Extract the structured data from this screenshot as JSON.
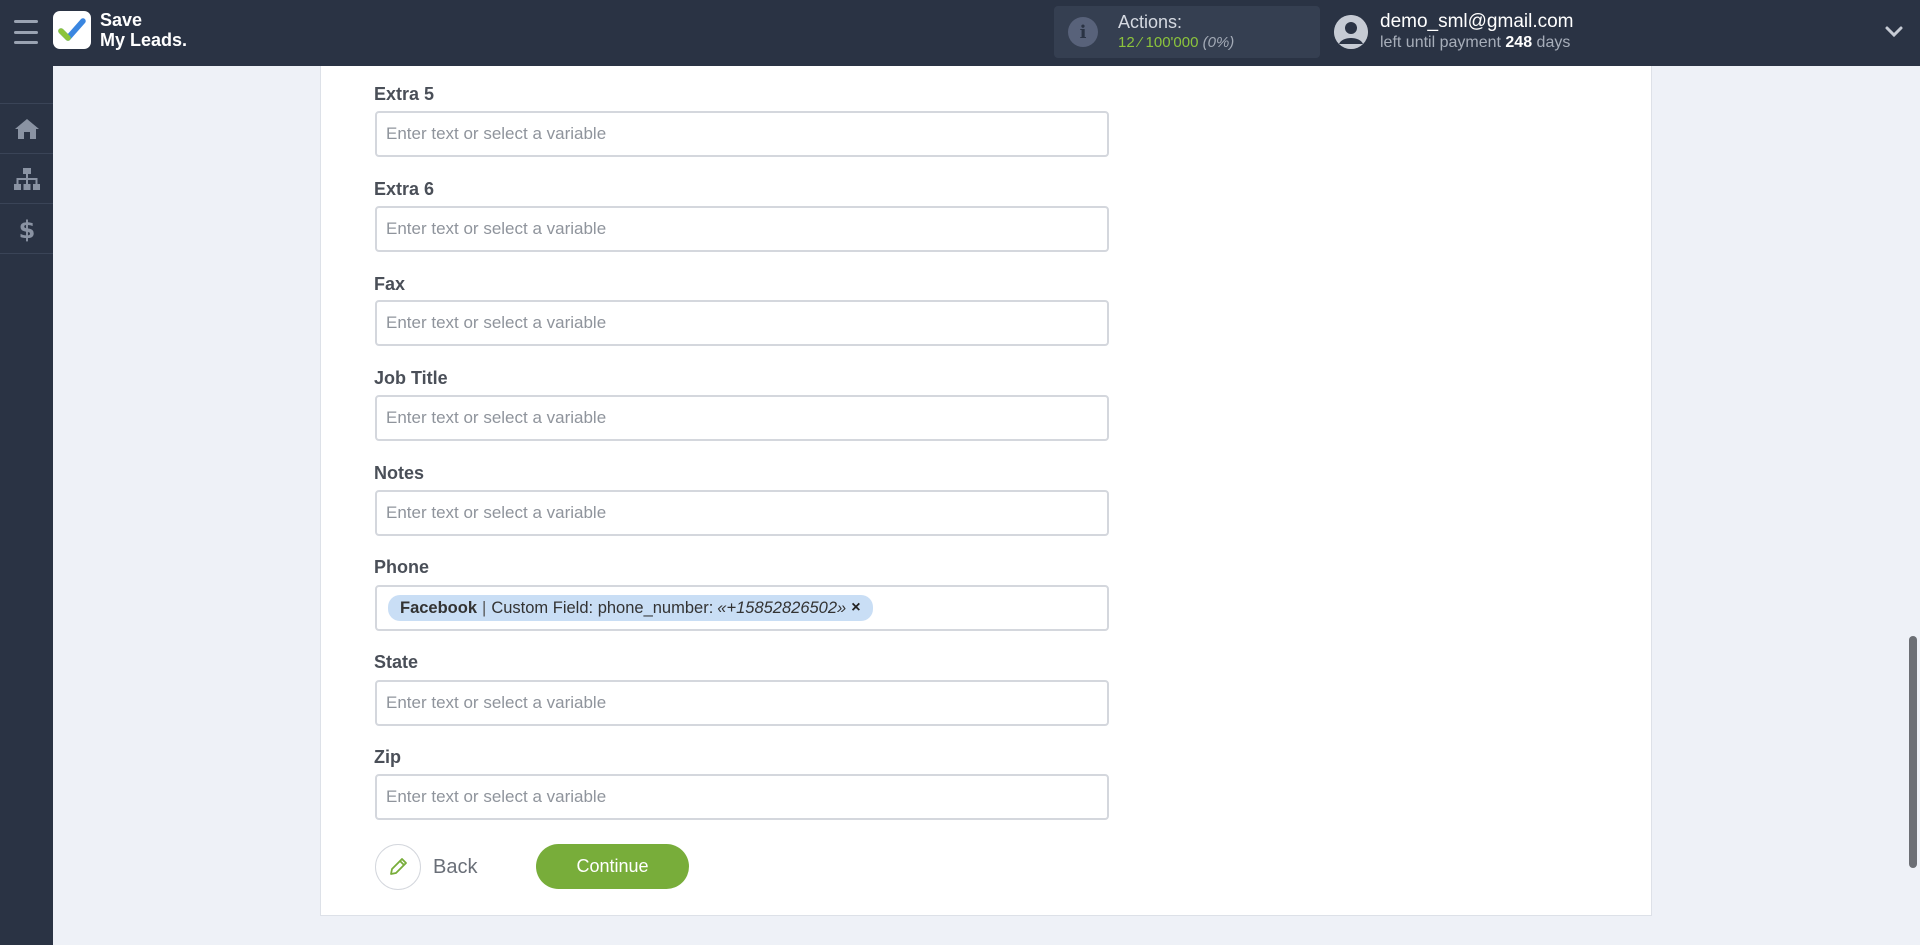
{
  "app": {
    "logo_line1": "Save",
    "logo_line2": "My Leads."
  },
  "header": {
    "actions_label": "Actions:",
    "actions_used": "12",
    "actions_separator": " ⁄ ",
    "actions_total": "100'000",
    "actions_percent": "(0%)",
    "user_email": "demo_sml@gmail.com",
    "payment_prefix": "left until payment ",
    "payment_days": "248",
    "payment_suffix": " days"
  },
  "sidebar": {
    "items": [
      {
        "icon": "home-icon"
      },
      {
        "icon": "sitemap-icon"
      },
      {
        "icon": "dollar-icon"
      }
    ]
  },
  "form": {
    "placeholder": "Enter text or select a variable",
    "fields": {
      "extra5": {
        "label": "Extra 5",
        "value": ""
      },
      "extra6": {
        "label": "Extra 6",
        "value": ""
      },
      "fax": {
        "label": "Fax",
        "value": ""
      },
      "job_title": {
        "label": "Job Title",
        "value": ""
      },
      "notes": {
        "label": "Notes",
        "value": ""
      },
      "phone": {
        "label": "Phone",
        "tag_source": "Facebook",
        "tag_separator": "|",
        "tag_field": "Custom Field: phone_number:",
        "tag_value": "«+15852826502»",
        "tag_close": "×"
      },
      "state": {
        "label": "State",
        "value": ""
      },
      "zip": {
        "label": "Zip",
        "value": ""
      }
    }
  },
  "buttons": {
    "back_label": "Back",
    "continue_label": "Continue"
  },
  "colors": {
    "topbar": "#2a3344",
    "accent_green": "#78ad3a",
    "tag_blue": "#c9def5"
  }
}
